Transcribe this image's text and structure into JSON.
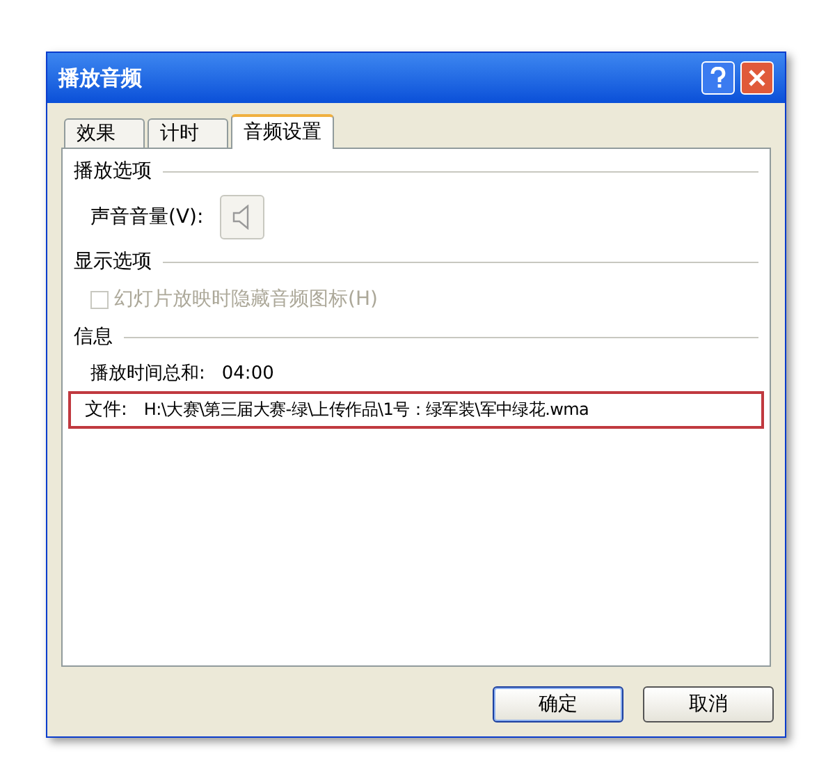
{
  "window": {
    "title": "播放音频"
  },
  "tabs": [
    {
      "label": "效果",
      "selected": false
    },
    {
      "label": "计时",
      "selected": false
    },
    {
      "label": "音频设置",
      "selected": true
    }
  ],
  "playback_options": {
    "heading": "播放选项",
    "volume_label": "声音音量(V):"
  },
  "display_options": {
    "heading": "显示选项",
    "hide_icon_checkbox": {
      "label": "幻灯片放映时隐藏音频图标(H)",
      "checked": false,
      "disabled": true
    }
  },
  "info": {
    "heading": "信息",
    "total_time_label": "播放时间总和:",
    "total_time": "04:00",
    "file_label": "文件:",
    "file_path": "H:\\大赛\\第三届大赛-绿\\上传作品\\1号：绿军装\\军中绿花.wma"
  },
  "buttons": [
    "确定",
    "取消"
  ]
}
